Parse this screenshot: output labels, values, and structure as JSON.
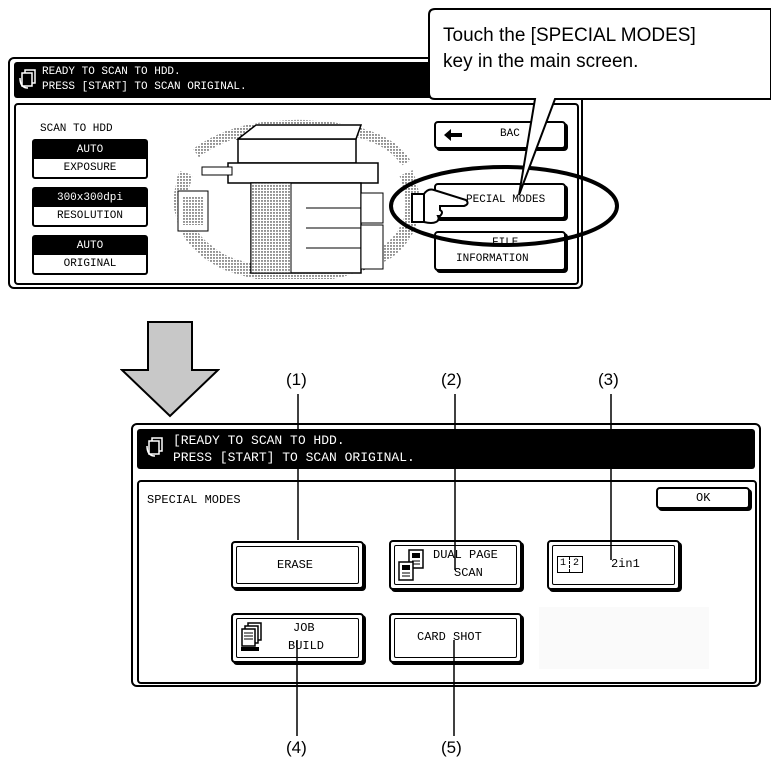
{
  "callout": {
    "line1": "Touch the [SPECIAL MODES]",
    "line2": "key in the main screen."
  },
  "main_screen": {
    "status_line1": "READY TO SCAN TO HDD.",
    "status_line2": "PRESS [START] TO SCAN ORIGINAL.",
    "mode_label": "SCAN TO HDD",
    "exposure_value": "AUTO",
    "exposure_label": "EXPOSURE",
    "resolution_value": "300x300dpi",
    "resolution_label": "RESOLUTION",
    "original_value": "AUTO",
    "original_label": "ORIGINAL",
    "back_label": "BAC",
    "special_modes_label": "PECIAL MODES",
    "file_label": "FILE",
    "information_label": "INFORMATION"
  },
  "special_screen": {
    "status_line1": "[READY TO SCAN TO HDD.",
    "status_line2": "PRESS [START] TO SCAN ORIGINAL.",
    "title": "SPECIAL MODES",
    "ok_label": "OK",
    "erase_label": "ERASE",
    "dual_page_line1": "DUAL PAGE",
    "dual_page_line2": "SCAN",
    "twoin1_label": "2in1",
    "twoin1_icon_left": "1",
    "twoin1_icon_right": "2",
    "job_build_line1": "JOB",
    "job_build_line2": "BUILD",
    "card_shot_label": "CARD SHOT"
  },
  "callout_numbers": {
    "n1": "(1)",
    "n2": "(2)",
    "n3": "(3)",
    "n4": "(4)",
    "n5": "(5)"
  },
  "colors": {
    "ink": "#000000",
    "paper": "#ffffff",
    "arrow_fill": "#c8c8c8"
  }
}
